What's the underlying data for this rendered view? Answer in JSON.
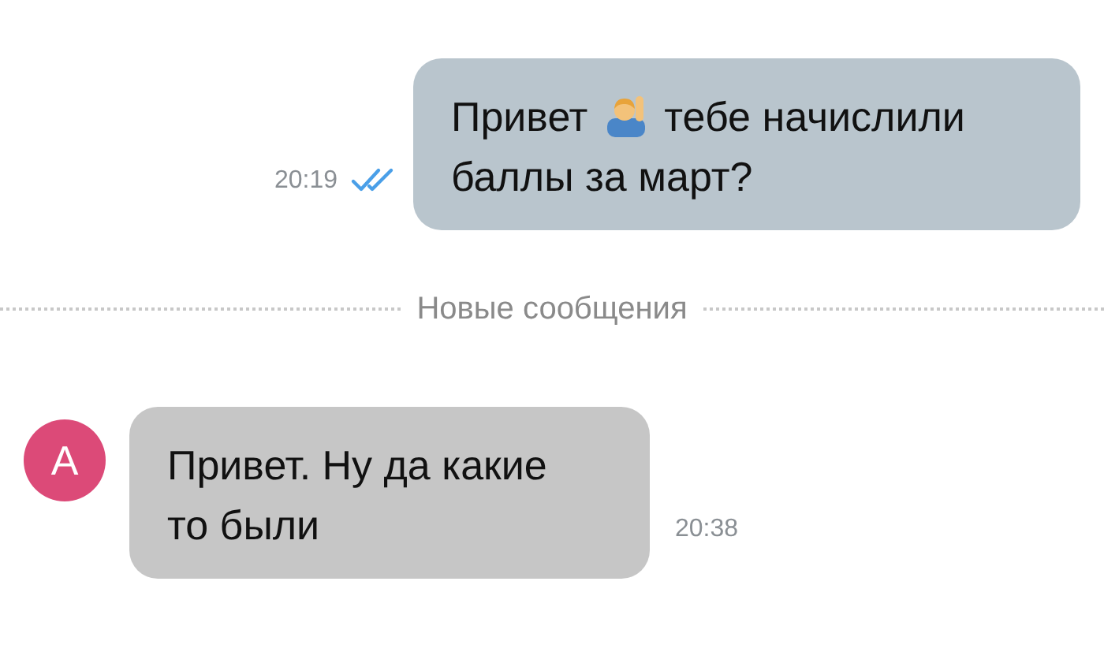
{
  "messages": [
    {
      "kind": "outgoing",
      "text_before": "Привет",
      "text_after": "тебе начислили",
      "text_line2": "баллы за март?",
      "time": "20:19",
      "read": true
    },
    {
      "kind": "divider",
      "text": "Новые сообщения"
    },
    {
      "kind": "incoming",
      "avatar": "А",
      "text": "Привет. Ну да какие то были",
      "time": "20:38"
    }
  ]
}
